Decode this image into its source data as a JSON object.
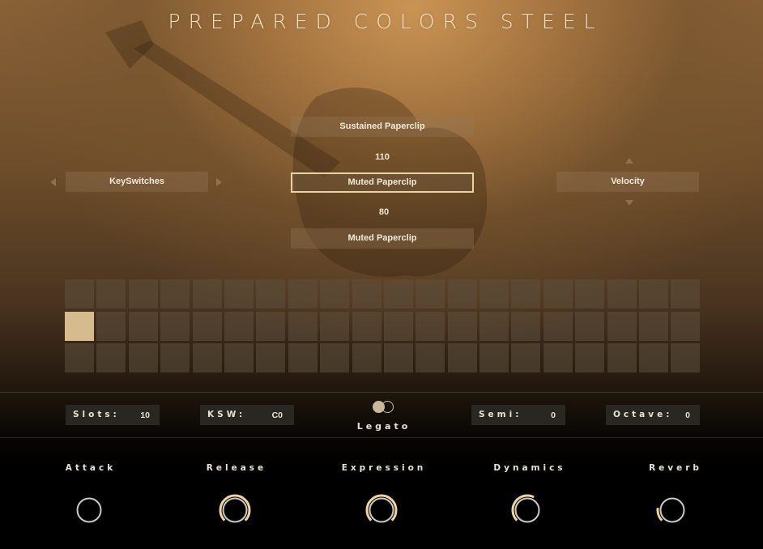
{
  "header": {
    "title": "PREPARED COLORS STEEL"
  },
  "articulations": {
    "top": {
      "label": "Sustained Paperclip",
      "velocity": "110"
    },
    "middle": {
      "label": "Muted Paperclip",
      "selected": true,
      "velocity": "80"
    },
    "bottom": {
      "label": "Muted Paperclip"
    }
  },
  "mode_selector": {
    "label": "KeySwitches"
  },
  "trigger_selector": {
    "label": "Velocity"
  },
  "slot_grid": {
    "columns": 20,
    "rows": 3,
    "active_slot": {
      "row": 2,
      "column": 1
    },
    "enabled_columns": 10
  },
  "settings": {
    "slots": {
      "label": "Slots:",
      "value": "10"
    },
    "ksw": {
      "label": "KSW:",
      "value": "C0"
    },
    "legato": {
      "label": "Legato",
      "on": true
    },
    "semi": {
      "label": "Semi:",
      "value": "0"
    },
    "octave": {
      "label": "Octave:",
      "value": "0"
    }
  },
  "knobs": [
    {
      "label": "Attack",
      "value": 0.0
    },
    {
      "label": "Release",
      "value": 1.0
    },
    {
      "label": "Expression",
      "value": 1.0
    },
    {
      "label": "Dynamics",
      "value": 0.6
    },
    {
      "label": "Reverb",
      "value": 0.2
    }
  ],
  "colors": {
    "accent": "#f0d3a0",
    "knob_ring": "#c9c9c9",
    "active_slot": "#d6bb8e"
  }
}
